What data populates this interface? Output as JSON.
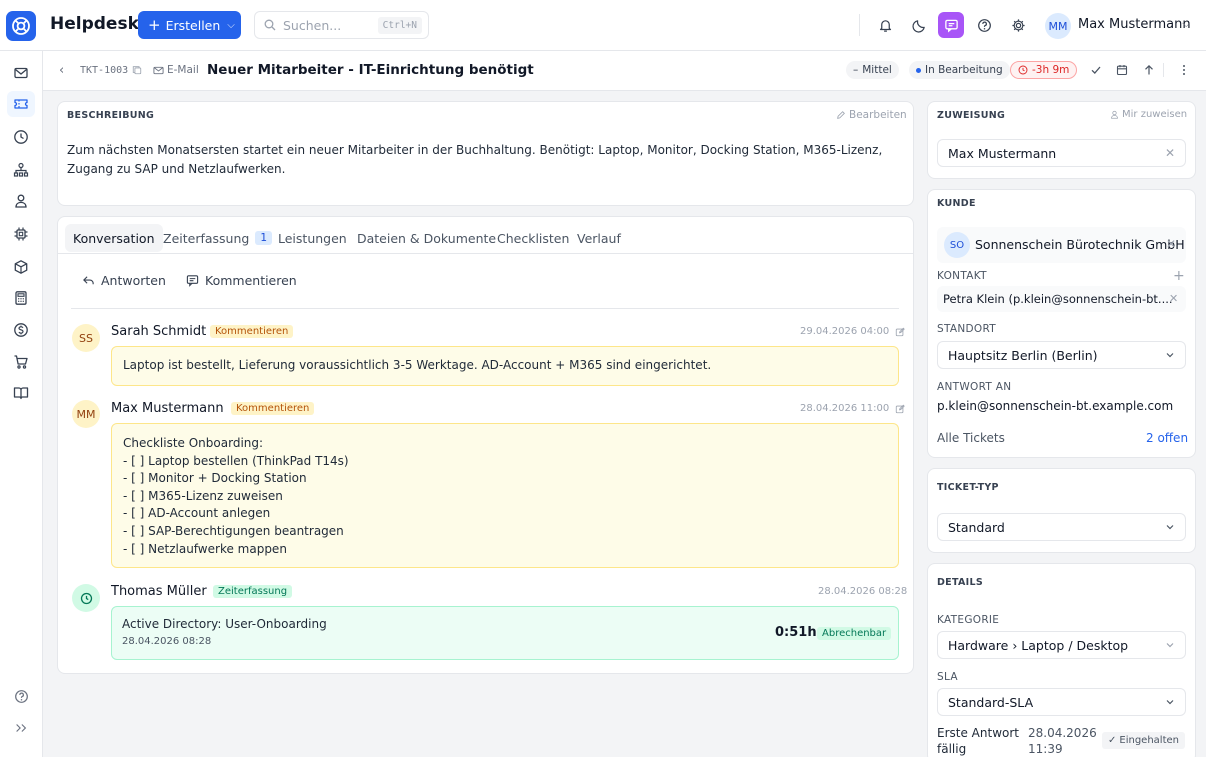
{
  "header": {
    "app_title": "Helpdesk",
    "create_label": "Erstellen",
    "search_placeholder": "Suchen...",
    "search_shortcut": "Ctrl+N",
    "user_initials": "MM",
    "user_name": "Max Mustermann"
  },
  "ticket": {
    "id": "TKT-1003",
    "channel": "E-Mail",
    "title": "Neuer Mitarbeiter - IT-Einrichtung benötigt",
    "priority": "Mittel",
    "status": "In Bearbeitung",
    "sla": "-3h 9m"
  },
  "description": {
    "label": "BESCHREIBUNG",
    "edit_label": "Bearbeiten",
    "text": "Zum nächsten Monatsersten startet ein neuer Mitarbeiter in der Buchhaltung. Benötigt: Laptop, Monitor, Docking Station, M365-Lizenz, Zugang zu SAP und Netzlaufwerken."
  },
  "tabs": [
    {
      "label": "Konversation"
    },
    {
      "label": "Zeiterfassung",
      "badge": "1"
    },
    {
      "label": "Leistungen"
    },
    {
      "label": "Dateien & Dokumente"
    },
    {
      "label": "Checklisten"
    },
    {
      "label": "Verlauf"
    }
  ],
  "actions": {
    "reply": "Antworten",
    "comment": "Kommentieren"
  },
  "messages": [
    {
      "initials": "SS",
      "author": "Sarah Schmidt",
      "tag": "Kommentieren",
      "date": "29.04.2026 04:00",
      "body": "Laptop ist bestellt, Lieferung voraussichtlich 3-5 Werktage. AD-Account + M365 sind eingerichtet."
    },
    {
      "initials": "MM",
      "author": "Max Mustermann",
      "tag": "Kommentieren",
      "date": "28.04.2026 11:00",
      "lines": [
        "Checkliste Onboarding:",
        "- [ ] Laptop bestellen (ThinkPad T14s)",
        "- [ ] Monitor + Docking Station",
        "- [ ] M365-Lizenz zuweisen",
        "- [ ] AD-Account anlegen",
        "- [ ] SAP-Berechtigungen beantragen",
        "- [ ] Netzlaufwerke mappen"
      ]
    },
    {
      "author": "Thomas Müller",
      "tag": "Zeiterfassung",
      "date": "28.04.2026 08:28",
      "entry_title": "Active Directory: User-Onboarding",
      "entry_date": "28.04.2026 08:28",
      "duration": "0:51h",
      "billable": "Abrechenbar"
    }
  ],
  "assignment": {
    "label": "ZUWEISUNG",
    "assign_me": "Mir zuweisen",
    "assignee": "Max Mustermann"
  },
  "customer": {
    "label": "KUNDE",
    "initials": "SO",
    "name": "Sonnenschein Bürotechnik GmbH",
    "contact_label": "KONTAKT",
    "contact": "Petra Klein (p.klein@sonnenschein-bt....",
    "location_label": "STANDORT",
    "location": "Hauptsitz Berlin (Berlin)",
    "reply_to_label": "ANTWORT AN",
    "reply_to": "p.klein@sonnenschein-bt.example.com",
    "all_tickets_label": "Alle Tickets",
    "open_tickets": "2 offen"
  },
  "ticket_type": {
    "label": "TICKET-TYP",
    "value": "Standard"
  },
  "details": {
    "label": "DETAILS",
    "category_label": "KATEGORIE",
    "category": "Hardware › Laptop / Desktop",
    "sla_label": "SLA",
    "sla_value": "Standard-SLA",
    "first_response_label_1": "Erste Antwort",
    "first_response_label_2": "fällig",
    "first_response_date": "28.04.2026",
    "first_response_time": "11:39",
    "first_response_status": "Eingehalten"
  },
  "colors": {
    "accent": "#2563eb",
    "chat": "#a855f7",
    "sla_overdue": "#dc2626",
    "comment_bg": "#fefce8",
    "time_bg": "#ecfdf5"
  }
}
